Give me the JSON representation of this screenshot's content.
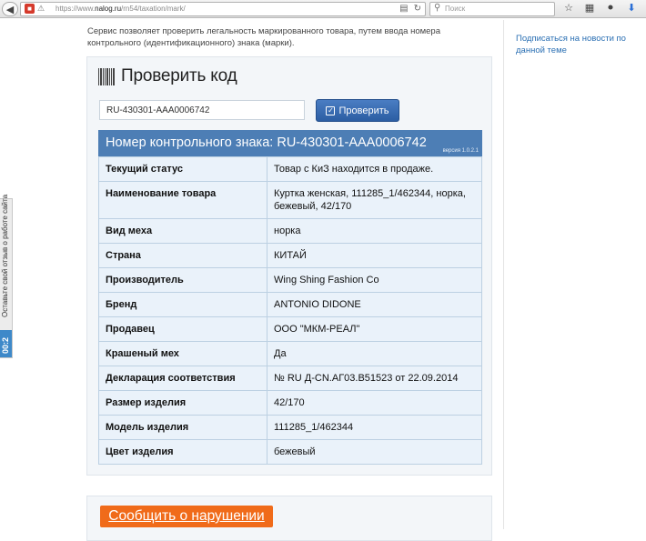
{
  "browser": {
    "url_prefix": "https://www.",
    "url_domain": "nalog.ru",
    "url_path": "/rn54/taxation/mark/",
    "search_placeholder": "Поиск"
  },
  "feedback": {
    "label": "Оставьте свой отзыв о работе сайта",
    "count": "00:2"
  },
  "intro": {
    "text": "Сервис позволяет проверить легальность маркированного товара, путем ввода номера контрольного (идентификационного) знака (марки).",
    "side_link": "Подписаться на новости по данной теме"
  },
  "check": {
    "title": "Проверить код",
    "input_value": "RU-430301-AAA0006742",
    "button_label": "Проверить"
  },
  "result": {
    "header": "Номер контрольного знака: RU-430301-AAA0006742",
    "version": "версия 1.0.2.1",
    "rows": [
      {
        "k": "Текущий статус",
        "v": "Товар с КиЗ находится в продаже."
      },
      {
        "k": "Наименование товара",
        "v": "Куртка женская, 111285_1/462344, норка, бежевый, 42/170"
      },
      {
        "k": "Вид меха",
        "v": "норка"
      },
      {
        "k": "Страна",
        "v": "КИТАЙ"
      },
      {
        "k": "Производитель",
        "v": "Wing Shing Fashion Co"
      },
      {
        "k": "Бренд",
        "v": "ANTONIO DIDONE"
      },
      {
        "k": "Продавец",
        "v": "ООО \"МКМ-РЕАЛ\""
      },
      {
        "k": "Крашеный мех",
        "v": "Да"
      },
      {
        "k": "Декларация соответствия",
        "v": "№ RU Д-CN.АГ03.В51523 от 22.09.2014"
      },
      {
        "k": "Размер изделия",
        "v": "42/170"
      },
      {
        "k": "Модель изделия",
        "v": "111285_1/462344"
      },
      {
        "k": "Цвет изделия",
        "v": "бежевый"
      }
    ]
  },
  "report": {
    "button_label": "Сообщить о нарушении"
  }
}
